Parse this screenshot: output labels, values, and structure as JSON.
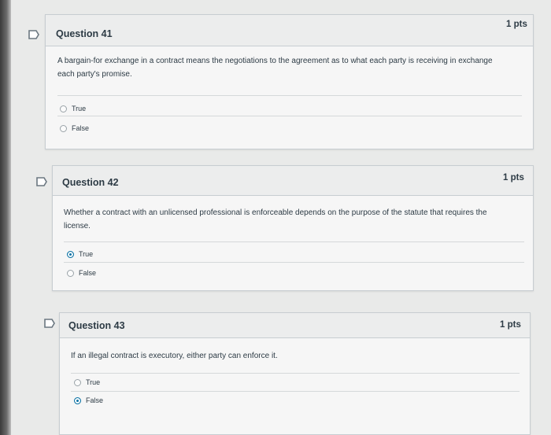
{
  "questions": [
    {
      "title": "Question 41",
      "points": "1 pts",
      "text_line1": "A bargain-for exchange in a contract means the negotiations to the agreement as to what each party is receiving in exchange",
      "text_line2": "each party's promise.",
      "answers": [
        {
          "label": "True",
          "selected": false
        },
        {
          "label": "False",
          "selected": false
        }
      ]
    },
    {
      "title": "Question 42",
      "points": "1 pts",
      "text_line1": "Whether a contract with an unlicensed professional is enforceable depends on the purpose of the statute that requires the",
      "text_line2": "license.",
      "answers": [
        {
          "label": "True",
          "selected": true
        },
        {
          "label": "False",
          "selected": false
        }
      ]
    },
    {
      "title": "Question 43",
      "points": "1 pts",
      "text_line1": "If an illegal contract is executory, either party can enforce it.",
      "answers": [
        {
          "label": "True",
          "selected": false
        },
        {
          "label": "False",
          "selected": true
        }
      ]
    }
  ],
  "colors": {
    "accent": "#0770a3",
    "text": "#2d3b45",
    "border": "#c7cdd1"
  },
  "icons": {
    "flag": "bookmark-flag-icon",
    "radio": "radio-button-icon"
  }
}
